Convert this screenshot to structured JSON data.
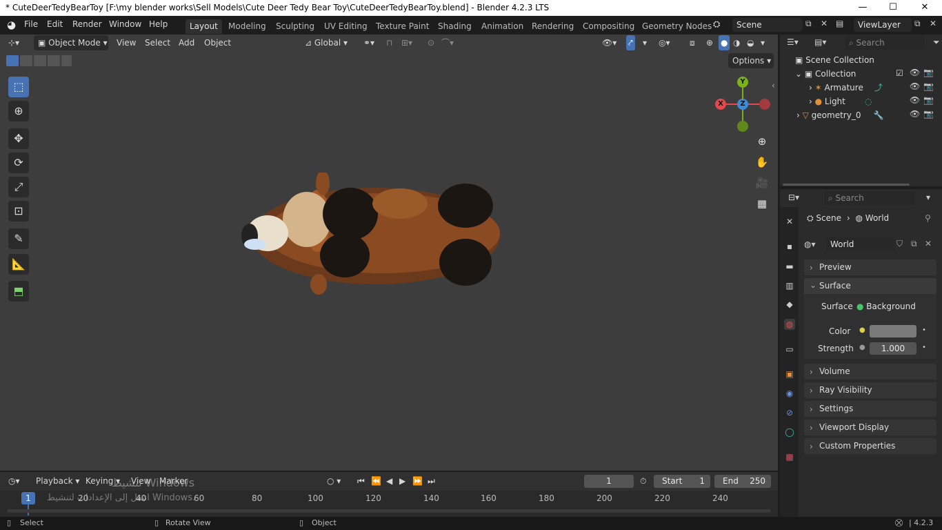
{
  "window": {
    "title": "* CuteDeerTedyBearToy [F:\\my blender works\\Sell Models\\Cute Deer Tedy Bear Toy\\CuteDeerTedyBearToy.blend] - Blender 4.2.3 LTS",
    "minimize": "—",
    "maximize": "☐",
    "close": "✕"
  },
  "menu": {
    "items": [
      "File",
      "Edit",
      "Render",
      "Window",
      "Help"
    ]
  },
  "workspaces": {
    "tabs": [
      "Layout",
      "Modeling",
      "Sculpting",
      "UV Editing",
      "Texture Paint",
      "Shading",
      "Animation",
      "Rendering",
      "Compositing",
      "Geometry Nodes"
    ],
    "active": "Layout"
  },
  "scene": {
    "name": "Scene"
  },
  "viewlayer": {
    "name": "ViewLayer"
  },
  "viewport_header": {
    "mode": "Object Mode",
    "menus": [
      "View",
      "Select",
      "Add",
      "Object"
    ],
    "orientation": "Global",
    "options_label": "Options"
  },
  "gizmo": {
    "x": "X",
    "y": "Y",
    "z": "Z",
    "colors": {
      "x": "#e5484d",
      "y": "#7ab317",
      "z": "#3a8cdb"
    }
  },
  "outliner": {
    "search_placeholder": "Search",
    "root": "Scene Collection",
    "collection": "Collection",
    "items": [
      "Armature",
      "Light",
      "geometry_0"
    ]
  },
  "properties": {
    "search_placeholder": "Search",
    "breadcrumb": [
      "Scene",
      "World"
    ],
    "datablock": "World",
    "panels": {
      "preview": "Preview",
      "surface": "Surface",
      "volume": "Volume",
      "ray_visibility": "Ray Visibility",
      "settings": "Settings",
      "viewport_display": "Viewport Display",
      "custom_properties": "Custom Properties"
    },
    "surface_label": "Surface",
    "surface_value": "Background",
    "color_label": "Color",
    "strength_label": "Strength",
    "strength_value": "1.000",
    "world_color": "#7a7a7a"
  },
  "timeline": {
    "menus": [
      "Playback",
      "Keying",
      "View",
      "Marker"
    ],
    "current_frame": "1",
    "start_label": "Start",
    "start_value": "1",
    "end_label": "End",
    "end_value": "250",
    "ticks": [
      "20",
      "40",
      "60",
      "80",
      "100",
      "120",
      "140",
      "160",
      "180",
      "200",
      "220",
      "240"
    ],
    "watermark_line1": "تنشيط Windows",
    "watermark_line2": "انتقل إلى الإعدادات لتنشيط Windows."
  },
  "status": {
    "select": "Select",
    "rotate": "Rotate View",
    "object": "Object",
    "version": "4.2.3"
  },
  "colors": {
    "accent": "#4772b3",
    "viewport_bg": "#3d3d3d"
  }
}
